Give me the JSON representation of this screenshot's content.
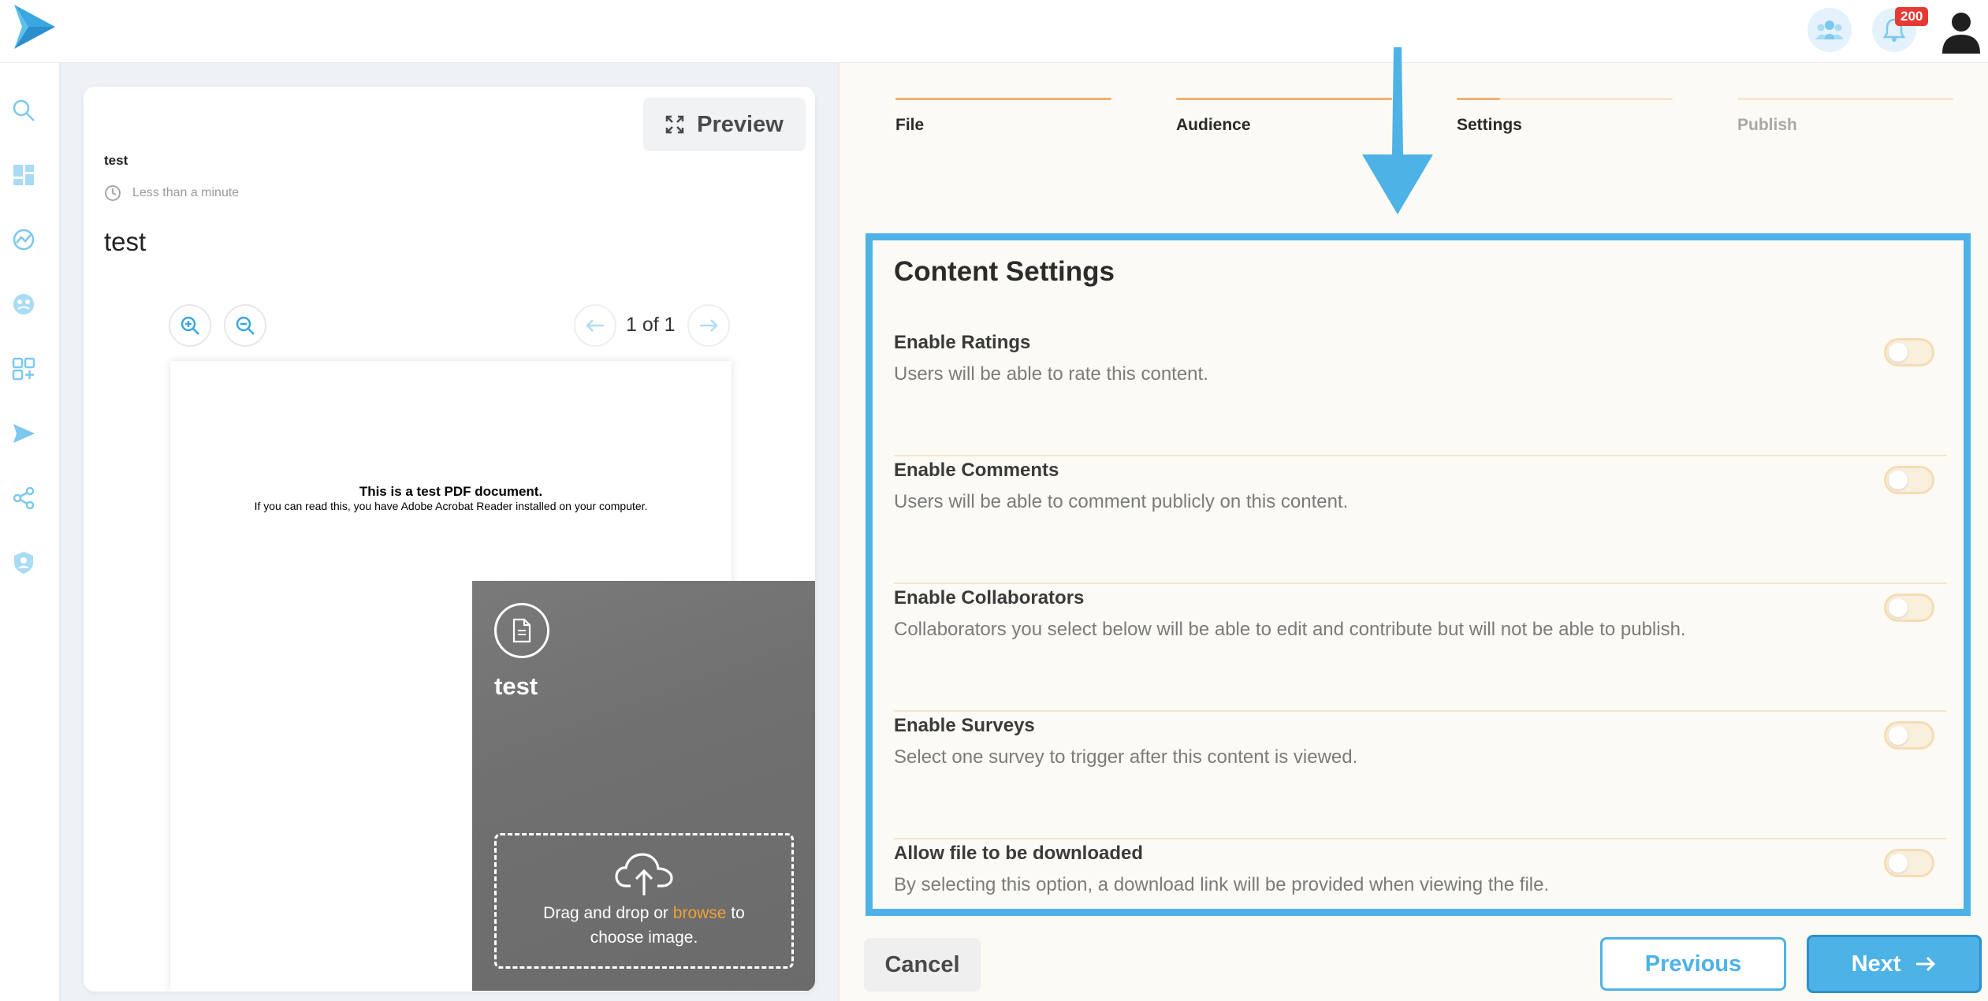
{
  "topbar": {
    "notification_count": "200",
    "icons": [
      "logo-icon",
      "team-icon",
      "bell-icon",
      "user-avatar-icon"
    ]
  },
  "sidebar": {
    "items": [
      {
        "icon": "search-icon"
      },
      {
        "icon": "dashboard-icon"
      },
      {
        "icon": "analytics-icon"
      },
      {
        "icon": "community-icon"
      },
      {
        "icon": "apps-add-icon"
      },
      {
        "icon": "send-icon"
      },
      {
        "icon": "share-icon"
      },
      {
        "icon": "shield-user-icon"
      }
    ]
  },
  "preview_card": {
    "preview_label": "Preview",
    "small_title": "test",
    "read_time": "Less than a minute",
    "big_title": "test",
    "page_indicator": "1 of 1",
    "pdf_title": "This is a test PDF document.",
    "pdf_subtitle": "If you can read this, you have Adobe Acrobat Reader installed on your computer."
  },
  "thumbnail": {
    "title": "test",
    "drop_text_before": "Drag and drop or ",
    "browse_label": "browse",
    "drop_text_after": " to",
    "drop_text_line2": "choose image."
  },
  "steps": [
    {
      "label": "File",
      "progress": 1.0,
      "active": true
    },
    {
      "label": "Audience",
      "progress": 1.0,
      "active": true
    },
    {
      "label": "Settings",
      "progress": 0.2,
      "active": true
    },
    {
      "label": "Publish",
      "progress": 0.0,
      "active": false
    }
  ],
  "content_settings": {
    "title": "Content Settings",
    "rows": [
      {
        "title": "Enable Ratings",
        "description": "Users will be able to rate this content.",
        "enabled": false
      },
      {
        "title": "Enable Comments",
        "description": "Users will be able to comment publicly on this content.",
        "enabled": false
      },
      {
        "title": "Enable Collaborators",
        "description": "Collaborators you select below will be able to edit and contribute but will not be able to publish.",
        "enabled": false
      },
      {
        "title": "Enable Surveys",
        "description": "Select one survey to trigger after this content is viewed.",
        "enabled": false
      },
      {
        "title": "Allow file to be downloaded",
        "description": "By selecting this option, a download link will be provided when viewing the file.",
        "enabled": false
      }
    ]
  },
  "footer": {
    "cancel_label": "Cancel",
    "previous_label": "Previous",
    "next_label": "Next"
  },
  "colors": {
    "accent_blue": "#4db2e6",
    "step_orange": "#f0b070",
    "badge_red": "#e53935",
    "panel_bg": "#fcfaf5"
  }
}
